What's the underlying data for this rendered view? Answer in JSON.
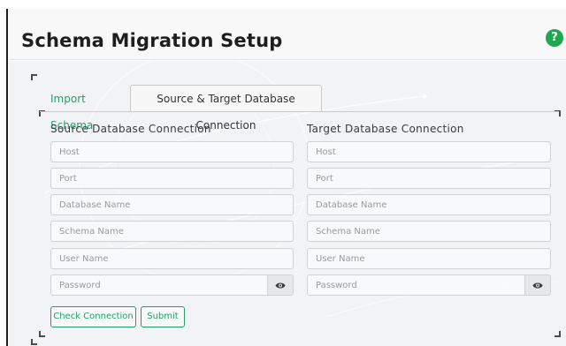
{
  "header": {
    "title": "Schema Migration Setup",
    "help_icon": "question-icon",
    "help_text": "?"
  },
  "tabs": [
    {
      "label": "Import Schema",
      "active": false
    },
    {
      "label": "Source & Target Database Connection",
      "active": true
    }
  ],
  "colors": {
    "accent": "#23a068",
    "help_bg": "#1ea653"
  },
  "source": {
    "title": "Source Database Connection",
    "fields": {
      "host": "Host",
      "port": "Port",
      "database_name": "Database Name",
      "schema_name": "Schema Name",
      "user_name": "User Name",
      "password": "Password"
    },
    "eye_icon": "eye-icon"
  },
  "target": {
    "title": "Target Database Connection",
    "fields": {
      "host": "Host",
      "port": "Port",
      "database_name": "Database Name",
      "schema_name": "Schema Name",
      "user_name": "User Name",
      "password": "Password"
    },
    "eye_icon": "eye-icon"
  },
  "actions": {
    "check_connection": "Check Connection",
    "submit": "Submit"
  }
}
